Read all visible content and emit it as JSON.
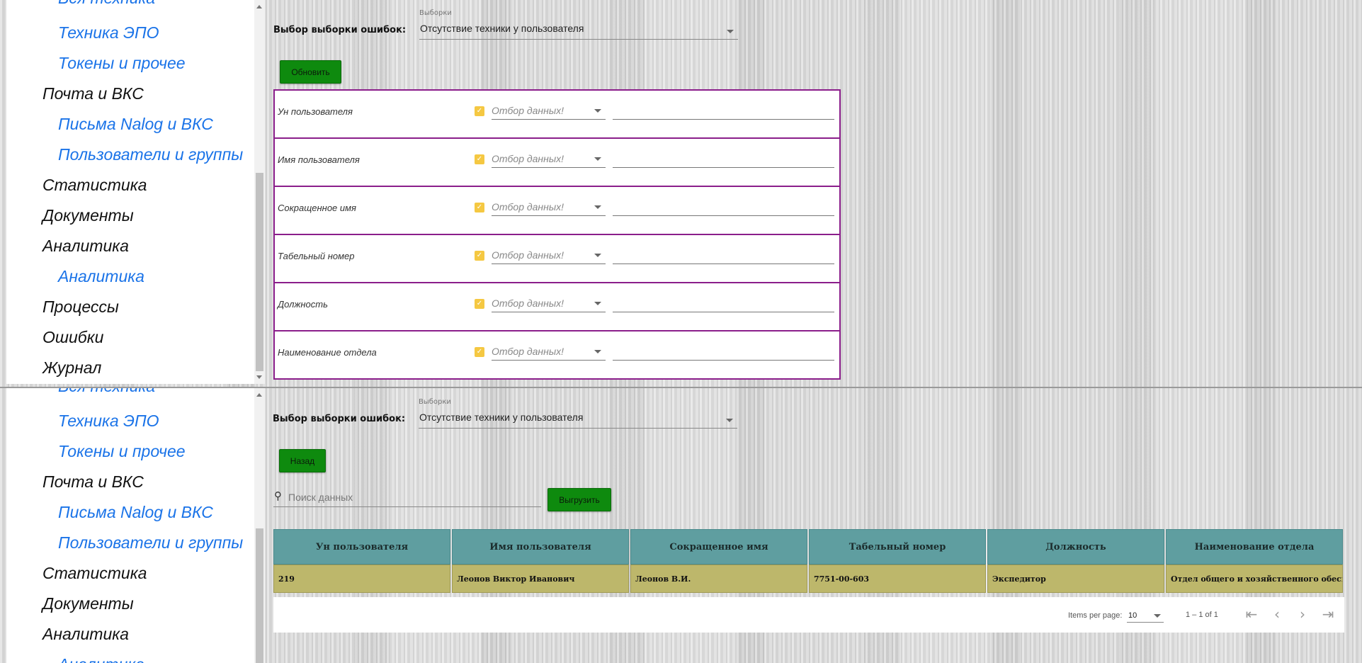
{
  "sidebar": {
    "items": [
      {
        "label": "Вся техника",
        "level": 2
      },
      {
        "label": "Техника ЭПО",
        "level": 2
      },
      {
        "label": "Токены и прочее",
        "level": 2
      },
      {
        "label": "Почта и ВКС",
        "level": 1
      },
      {
        "label": "Письма Nalog и ВКС",
        "level": 2
      },
      {
        "label": "Пользователи и группы",
        "level": 2
      },
      {
        "label": "Статистика",
        "level": 1
      },
      {
        "label": "Документы",
        "level": 1
      },
      {
        "label": "Аналитика",
        "level": 1
      },
      {
        "label": "Аналитика",
        "level": 2
      },
      {
        "label": "Процессы",
        "level": 1
      },
      {
        "label": "Ошибки",
        "level": 1
      },
      {
        "label": "Журнал",
        "level": 1
      }
    ]
  },
  "selector": {
    "label": "Выбор выборки ошибок:",
    "float_label": "Выборки",
    "value": "Отсутствие техники у пользователя"
  },
  "top": {
    "refresh_label": "Обновить",
    "filters": [
      {
        "name": "Ун пользователя"
      },
      {
        "name": "Имя пользователя"
      },
      {
        "name": "Сокращенное имя"
      },
      {
        "name": "Табельный номер"
      },
      {
        "name": "Должность"
      },
      {
        "name": "Наименование отдела"
      }
    ],
    "filter_placeholder": "Отбор данных!"
  },
  "bottom": {
    "back_label": "Назад",
    "export_label": "Выгрузить",
    "search_placeholder": "Поиск данных",
    "table": {
      "headers": [
        "Ун пользователя",
        "Имя пользователя",
        "Сокращенное имя",
        "Табельный номер",
        "Должность",
        "Наименование отдела"
      ],
      "rows": [
        [
          "219",
          "Леонов Виктор Иванович",
          "Леонов В.И.",
          "7751-00-603",
          "Экспедитор",
          "Отдел общего и хозяйственного обеспечения"
        ]
      ]
    },
    "paginator": {
      "items_per_page_label": "Items per page:",
      "items_per_page": "10",
      "range": "1 – 1 of 1"
    }
  },
  "colors": {
    "link_blue": "#1a73e8",
    "button_green": "#0e8a0e",
    "filter_border": "#8b1e8b",
    "header_teal": "#5f9ea0",
    "row_khaki": "#bdb76b",
    "checkbox_yellow": "#f5c842"
  }
}
